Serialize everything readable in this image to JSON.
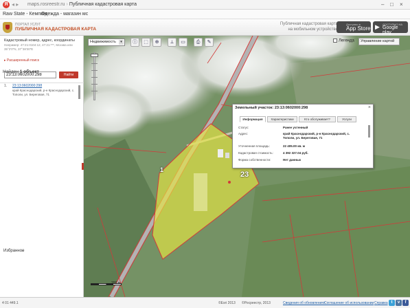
{
  "browser": {
    "logo_letter": "Я",
    "url": "maps.rosreestr.ru",
    "page_title": "Публичная кадастровая карта"
  },
  "bookmarks": [
    "Raw State - Кемпинг",
    "Одежда - магазин мс"
  ],
  "header": {
    "portal_small": "ПОРТАЛ УСЛУГ",
    "portal_name": "ПУБЛИЧНАЯ КАДАСТРОВАЯ КАРТА",
    "mobile_promo_line1": "Публичная кадастровая карта",
    "mobile_promo_line2": "на мобильном устройстве",
    "app_store_small": "Доступно в",
    "app_store": "App Store",
    "google_play_small": "ДОСТУПНО НА",
    "google_play": "Google play"
  },
  "search": {
    "title": "Кадастровый номер, адрес, координаты",
    "example": "Например: 47:21:0104:12, 47:21:***, Москва или 35°2'0\"N, 37°38'30\"E",
    "advanced": "Расширенный поиск",
    "value": "23:13:0602000:298",
    "button": "Найти"
  },
  "results": {
    "found_prefix": "Найден",
    "found_count": "1 объект",
    "items": [
      {
        "num": "1.",
        "cad": "23:13:0602000:298",
        "address": "край Краснодарский, р-н Краснодарский, с. Тополи, ул. Береговая, 71"
      }
    ]
  },
  "favorites": "Избранное",
  "favorites_arrow": "▸",
  "toolbar": {
    "layer_select": "Недвижимость",
    "legend": "Легенда",
    "map_control": "Управление картой"
  },
  "popup": {
    "title": "Земельный участок: 23:13:0602000:298",
    "tabs": [
      "Информация",
      "Характеристики",
      "Кто обслуживает?",
      "Услуги"
    ],
    "rows": [
      {
        "label": "Статус:",
        "value": "Ранее учтенный"
      },
      {
        "label": "Адрес:",
        "value": "край Краснодарский, р-н Краснодарский, с. Тополи, ул. Береговая, 71"
      },
      {
        "label": "Уточненная площадь:",
        "value": "22 405.00 кв. м"
      },
      {
        "label": "Кадастровая стоимость:",
        "value": "4 392 327.04 руб."
      },
      {
        "label": "Форма собственности:",
        "value": "Нет данных"
      }
    ]
  },
  "map": {
    "marker_label": "23",
    "scale_label": "200 м",
    "parcel_labels": [
      "1",
      "23"
    ],
    "colors": {
      "parcel_fill": "#e7e642",
      "boundary": "#d23a3a",
      "road": "#b3b3b3"
    }
  },
  "footer": {
    "coords": "4 01 449.1",
    "copyright_esri": "©Esri 2013",
    "copyright_rosreestr": "©Росреестр, 2013",
    "links": [
      "Сведения об обновлениях",
      "Соглашение об использовании",
      "Справка"
    ],
    "social": [
      "t",
      "v",
      "f"
    ]
  }
}
